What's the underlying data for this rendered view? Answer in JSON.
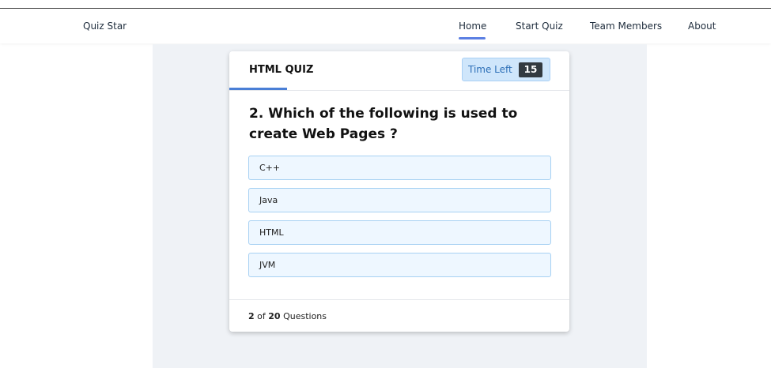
{
  "nav": {
    "brand": "Quiz Star",
    "items": [
      {
        "label": "Home",
        "active": true
      },
      {
        "label": "Start Quiz"
      },
      {
        "label": "Team Members"
      },
      {
        "label": "About"
      }
    ]
  },
  "quiz": {
    "title": "HTML QUIZ",
    "timer_label": "Time Left",
    "timer_value": "15",
    "question": "2. Which of the following is used to create Web Pages ?",
    "options": [
      "C++",
      "Java",
      "HTML",
      "JVM"
    ],
    "progress": {
      "current": "2",
      "of": "of",
      "total": "20",
      "suffix": "Questions"
    }
  },
  "colors": {
    "accent": "#5b7fe3",
    "timer_bg": "#cfe6fb",
    "option_bg": "#eef7ff",
    "option_border": "#a7d1f3",
    "content_bg": "#eff2f6"
  }
}
